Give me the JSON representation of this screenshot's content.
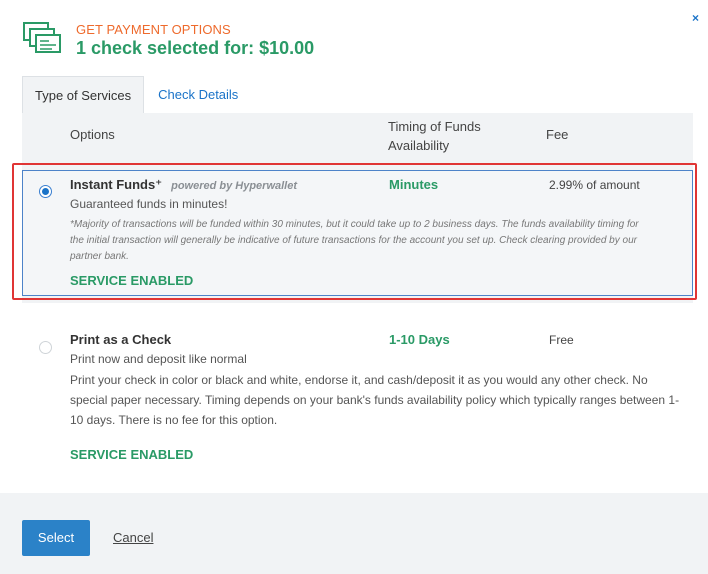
{
  "header": {
    "eyebrow": "GET PAYMENT OPTIONS",
    "title": "1 check selected for: $10.00",
    "close": "×"
  },
  "tabs": [
    {
      "label": "Type of Services",
      "active": true
    },
    {
      "label": "Check Details",
      "active": false
    }
  ],
  "columns": {
    "options": "Options",
    "timing_line1": "Timing of Funds",
    "timing_line2": "Availability",
    "fee": "Fee"
  },
  "options": [
    {
      "name": "Instant Funds⁺",
      "powered_by": "powered by Hyperwallet",
      "subtitle": "Guaranteed funds in minutes!",
      "fine_print_line1": "*Majority of transactions will be funded within 30 minutes, but it could take up to 2 business days. The funds availability timing for",
      "fine_print_line2": "the initial transaction will generally be indicative of future transactions for the account you set up. Check clearing provided by our",
      "fine_print_line3": "partner bank.",
      "timing": "Minutes",
      "fee": "2.99% of amount",
      "status": "SERVICE ENABLED",
      "selected": true
    },
    {
      "name": "Print as a Check",
      "subtitle": "Print now and deposit like normal",
      "description_line1": "Print your check in color or black and white, endorse it, and cash/deposit it as you would any other check. No",
      "description_line2": "special paper necessary. Timing depends on your bank's funds availability policy which typically ranges between 1-",
      "description_line3": "10 days. There is no fee for this option.",
      "timing": "1-10 Days",
      "fee": "Free",
      "status": "SERVICE ENABLED",
      "selected": false
    }
  ],
  "footer": {
    "select_label": "Select",
    "cancel_label": "Cancel"
  },
  "colors": {
    "accent_green": "#2a9a66",
    "eyebrow_orange": "#ee6a2c",
    "primary_blue": "#2b82c8",
    "highlight_red": "#e03535"
  }
}
